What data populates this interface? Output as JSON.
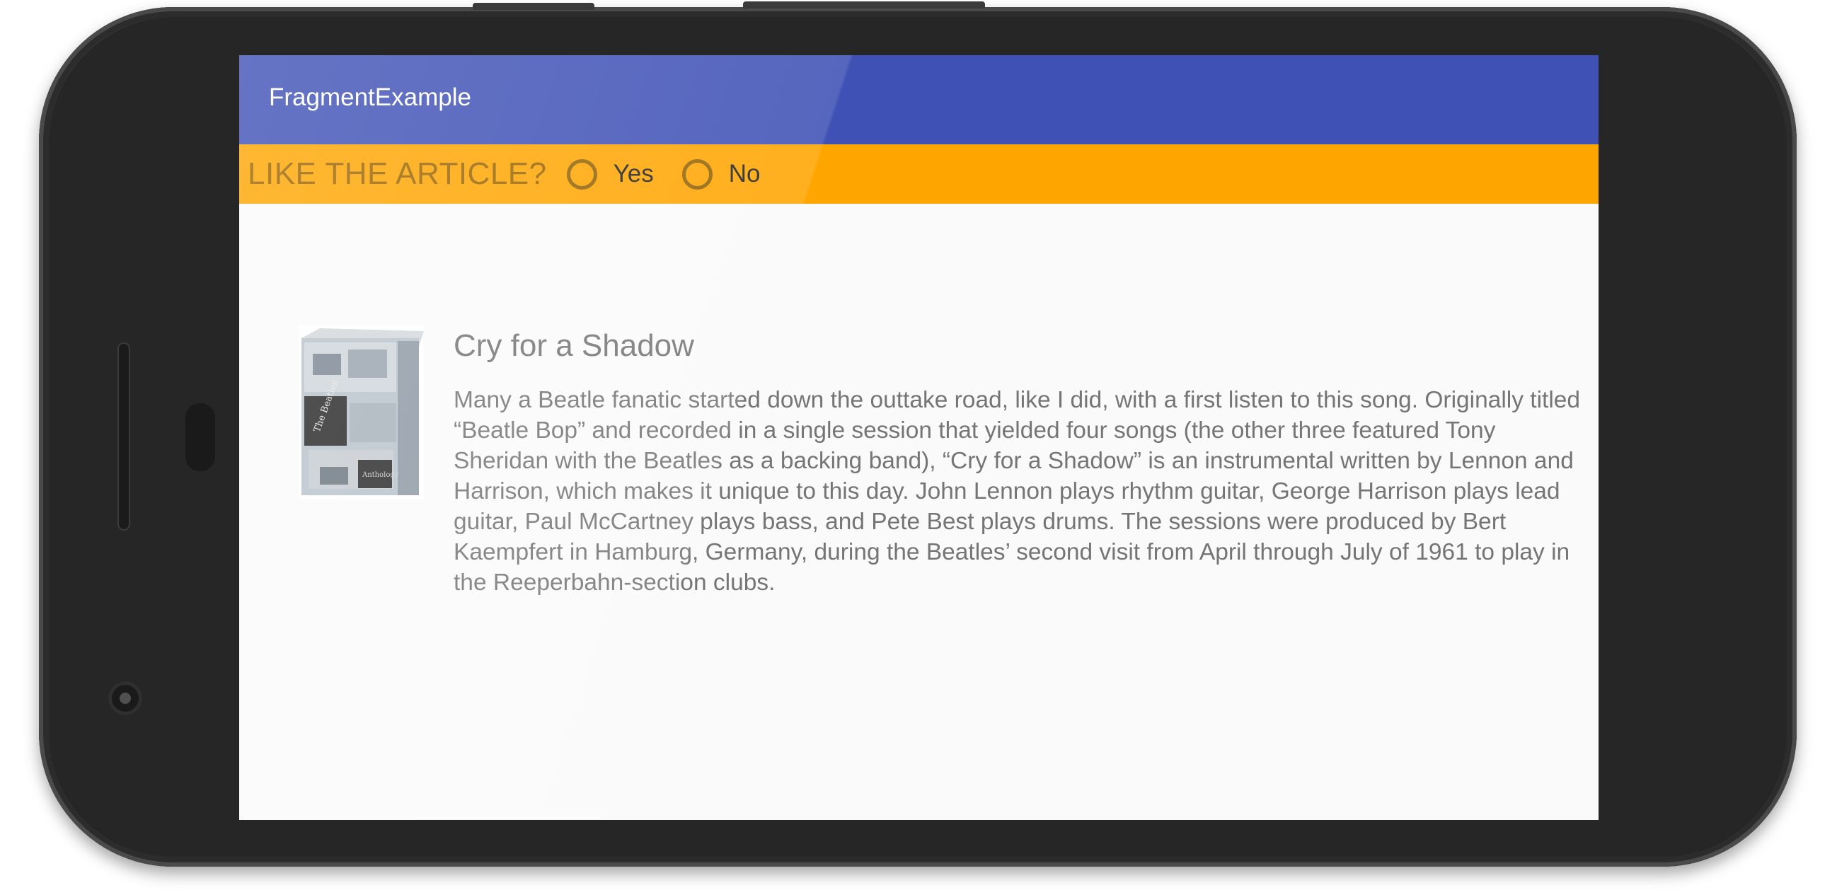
{
  "app": {
    "title": "FragmentExample"
  },
  "fragment": {
    "question": "LIKE THE ARTICLE?",
    "options": [
      {
        "label": "Yes",
        "checked": false
      },
      {
        "label": "No",
        "checked": false
      }
    ]
  },
  "article": {
    "heading": "Cry for a Shadow",
    "body": "Many a Beatle fanatic started down the outtake road, like I did, with a first listen to this song. Originally titled “Beatle Bop” and recorded in a single session that yielded four songs (the other three featured Tony Sheridan with the Beatles as a backing band), “Cry for a Shadow” is an instrumental written by Lennon and Harrison, which makes it unique to this day. John Lennon plays rhythm guitar, George Harrison plays lead guitar, Paul McCartney plays bass, and Pete Best plays drums. The sessions were produced by Bert Kaempfert in Hamburg, Germany, during the Beatles’ second visit from April through July of 1961 to play in the Reeperbahn-section clubs.",
    "image_lettering": [
      "The Beatles",
      "Anthology"
    ]
  },
  "colors": {
    "app_bar": "#3f51b5",
    "fragment_bar": "#ffa500",
    "question_text": "#9a6400",
    "body_text": "#757575",
    "screen_background": "#fafafa",
    "phone_body": "#262626"
  },
  "icons": {
    "radio_unchecked": "radio-unchecked-icon"
  }
}
